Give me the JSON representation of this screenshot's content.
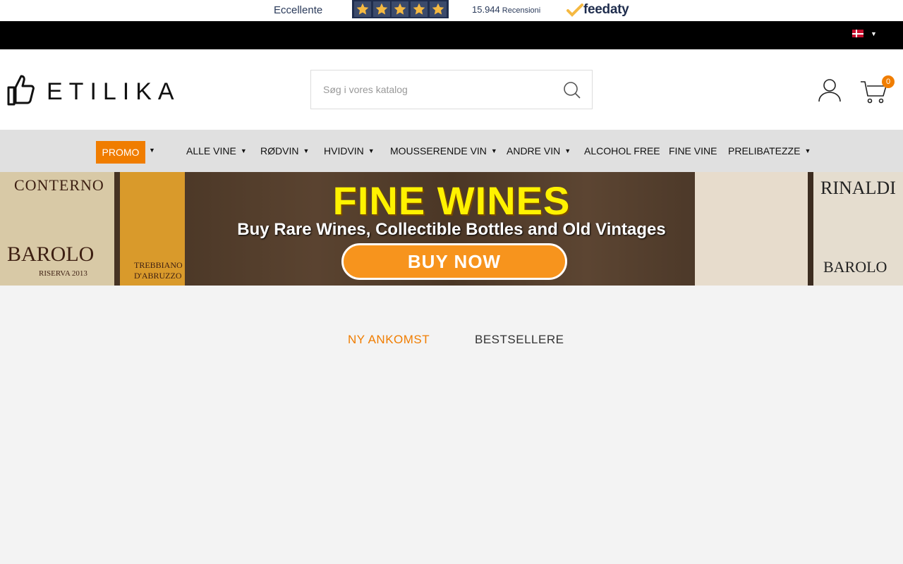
{
  "review_bar": {
    "rating_label": "Eccellente",
    "stars": 5,
    "review_count": "15.944",
    "reviews_label": "Recensioni",
    "provider": "feedaty",
    "star_color": "#f5b942",
    "star_bg": "#1f2d4d"
  },
  "top_bar": {
    "language_icon": "danish-flag-icon"
  },
  "header": {
    "logo_text": "ETILIKA",
    "search": {
      "placeholder": "Søg i vores katalog"
    },
    "cart_count": "0"
  },
  "nav": {
    "promo": "PROMO",
    "items": [
      {
        "label": "ALLE VINE",
        "has_caret": true
      },
      {
        "label": "RØDVIN",
        "has_caret": true
      },
      {
        "label": "HVIDVIN",
        "has_caret": true
      },
      {
        "label": "MOUSSERENDE VIN",
        "has_caret": true
      },
      {
        "label": "ANDRE VIN",
        "has_caret": true
      },
      {
        "label": "ALCOHOL FREE",
        "has_caret": false
      },
      {
        "label": "FINE VINE",
        "has_caret": false
      },
      {
        "label": "PRELIBATEZZE",
        "has_caret": true
      }
    ]
  },
  "banner": {
    "title": "FINE WINES",
    "subtitle": "Buy Rare Wines, Collectible Bottles and Old Vintages",
    "button": "BUY NOW",
    "bottle_labels": {
      "left_producer": "CONTERNO",
      "left_wine": "BAROLO",
      "left_note": "RISERVA 2013",
      "middle_wine": "TREBBIANO D'ABRUZZO",
      "right_producer": "RINALDI",
      "right_wine": "BAROLO"
    }
  },
  "tabs": {
    "new_arrivals": "NY ANKOMST",
    "bestsellers": "BESTSELLERE"
  },
  "colors": {
    "accent": "#f07d00",
    "nav_bg": "#e0e0e0",
    "page_bg": "#f3f3f3"
  }
}
